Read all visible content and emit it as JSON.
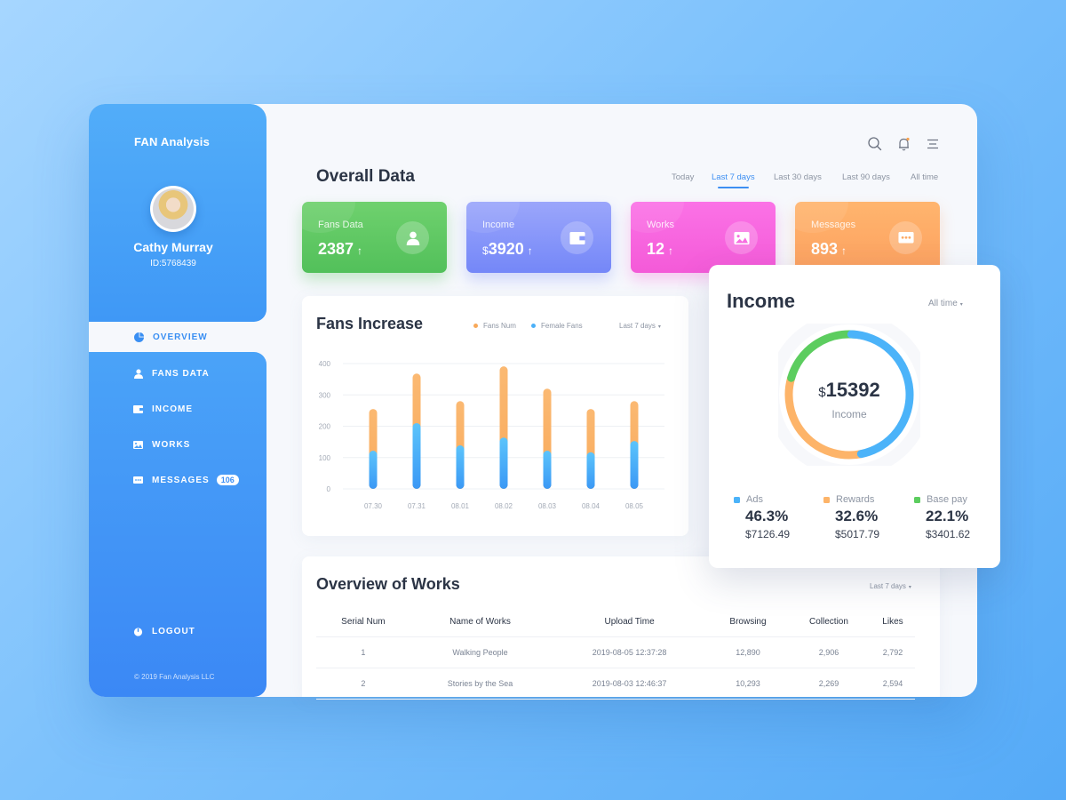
{
  "app": {
    "brand": "FAN Analysis",
    "copyright": "© 2019 Fan Analysis LLC"
  },
  "user": {
    "name": "Cathy Murray",
    "id": "ID:5768439"
  },
  "sidebar": {
    "items": [
      {
        "label": "OVERVIEW",
        "icon": "pie-chart-icon",
        "active": true
      },
      {
        "label": "FANS DATA",
        "icon": "user-icon"
      },
      {
        "label": "INCOME",
        "icon": "wallet-icon"
      },
      {
        "label": "WORKS",
        "icon": "image-icon"
      },
      {
        "label": "MESSAGES",
        "icon": "message-icon",
        "badge": "106"
      }
    ],
    "logout": "LOGOUT"
  },
  "header": {
    "icons": [
      "search-icon",
      "bell-icon",
      "menu-icon"
    ],
    "title": "Overall Data",
    "tabs": [
      {
        "label": "Today"
      },
      {
        "label": "Last 7 days",
        "active": true
      },
      {
        "label": "Last 30 days"
      },
      {
        "label": "Last 90 days"
      },
      {
        "label": "All time"
      }
    ]
  },
  "stats": [
    {
      "label": "Fans Data",
      "currency": "",
      "value": "2387",
      "trend": "↑",
      "icon": "user-icon",
      "color_from": "#6fd16e",
      "color_to": "#52c05a"
    },
    {
      "label": "Income",
      "currency": "$",
      "value": "3920",
      "trend": "↑",
      "icon": "wallet-icon",
      "color_from": "#9ba6fb",
      "color_to": "#7487f8"
    },
    {
      "label": "Works",
      "currency": "",
      "value": "12",
      "trend": "↑",
      "icon": "image-icon",
      "color_from": "#fb72e6",
      "color_to": "#f45ad8"
    },
    {
      "label": "Messages",
      "currency": "",
      "value": "893",
      "trend": "↑",
      "icon": "message-icon",
      "color_from": "#ffb56e",
      "color_to": "#fca05f"
    }
  ],
  "fans_increase": {
    "title": "Fans Increase",
    "legend": [
      {
        "label": "Fans Num",
        "color": "#f8a95a"
      },
      {
        "label": "Female Fans",
        "color": "#4bb0f8"
      }
    ],
    "range": "Last 7 days"
  },
  "chart_data": {
    "type": "bar",
    "title": "Fans Increase",
    "xlabel": "",
    "ylabel": "",
    "categories": [
      "07.30",
      "07.31",
      "08.01",
      "08.02",
      "08.03",
      "08.04",
      "08.05"
    ],
    "series": [
      {
        "name": "Fans Num",
        "values": [
          255,
          368,
          280,
          391,
          320,
          255,
          280
        ]
      },
      {
        "name": "Female Fans",
        "values": [
          122,
          210,
          139,
          164,
          122,
          117,
          153
        ]
      }
    ],
    "yticks": [
      0,
      100,
      200,
      300,
      400
    ],
    "ylim": [
      0,
      400
    ],
    "grid": true,
    "legend_position": "top-right"
  },
  "income": {
    "title": "Income",
    "range": "All time",
    "total_currency": "$",
    "total": "15392",
    "total_label": "Income",
    "segments": [
      {
        "label": "Ads",
        "percent": "46.3%",
        "fraction": 0.463,
        "amount": "$7126.49",
        "color": "#4bb3f9"
      },
      {
        "label": "Rewards",
        "percent": "32.6%",
        "fraction": 0.326,
        "amount": "$5017.79",
        "color": "#fdb469"
      },
      {
        "label": "Base pay",
        "percent": "22.1%",
        "fraction": 0.221,
        "amount": "$3401.62",
        "color": "#5ccd5f"
      }
    ]
  },
  "works": {
    "title": "Overview of Works",
    "range": "Last 7 days",
    "columns": [
      "Serial Num",
      "Name of Works",
      "Upload Time",
      "Browsing",
      "Collection",
      "Likes"
    ],
    "rows": [
      [
        "1",
        "Walking People",
        "2019-08-05 12:37:28",
        "12,890",
        "2,906",
        "2,792"
      ],
      [
        "2",
        "Stories by the Sea",
        "2019-08-03 12:46:37",
        "10,293",
        "2,269",
        "2,594"
      ]
    ]
  }
}
